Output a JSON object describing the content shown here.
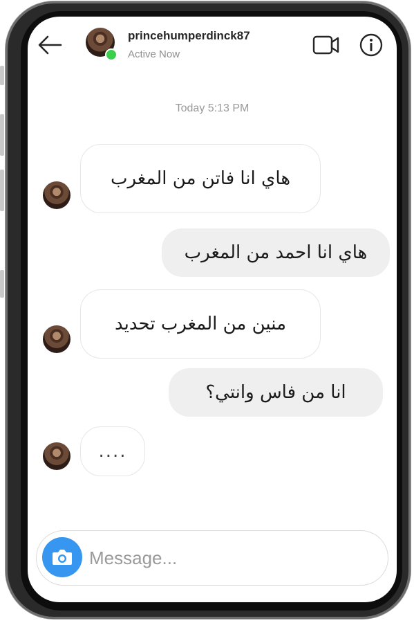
{
  "header": {
    "username": "princehumperdinck87",
    "status": "Active Now",
    "icons": {
      "back": "back-arrow-icon",
      "video": "video-camera-icon",
      "info": "info-icon"
    }
  },
  "thread": {
    "timestamp": "Today 5:13 PM",
    "messages": [
      {
        "direction": "incoming",
        "text": "هاي  انا فاتن من المغرب"
      },
      {
        "direction": "outgoing",
        "text": "هاي انا احمد من المغرب"
      },
      {
        "direction": "incoming",
        "text": "منين من المغرب تحديد"
      },
      {
        "direction": "outgoing",
        "text": "انا من فاس وانتي؟"
      },
      {
        "direction": "incoming",
        "text": "...."
      }
    ]
  },
  "composer": {
    "placeholder": "Message...",
    "camera_icon": "camera-icon",
    "accent": "#3797f0"
  },
  "colors": {
    "online": "#3ccf4e",
    "outgoing_bubble": "#efefef",
    "incoming_border": "#e6e6e6"
  }
}
